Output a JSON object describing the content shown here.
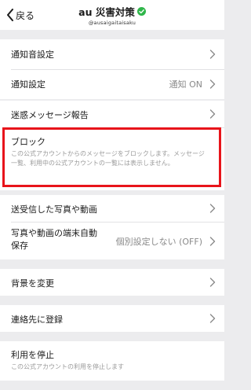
{
  "header": {
    "back_label": "戻る",
    "title": "au 災害対策",
    "handle": "@ausaigaitaisaku"
  },
  "settings": {
    "notification_sound": {
      "label": "通知音設定"
    },
    "notification": {
      "label": "通知設定",
      "value": "通知 ON"
    },
    "spam_report": {
      "label": "迷惑メッセージ報告"
    },
    "block": {
      "label": "ブロック",
      "description": "この公式アカウントからのメッセージをブロックします。メッセージ一覧、利用中の公式アカウントの一覧には表示しません。"
    },
    "sent_media": {
      "label": "送受信した写真や動画"
    },
    "auto_save": {
      "label_line1": "写真や動画の端末自動",
      "label_line2": "保存",
      "value": "個別設定しない (OFF)"
    },
    "background": {
      "label": "背景を変更"
    },
    "register_contact": {
      "label": "連絡先に登録"
    },
    "stop_using": {
      "label": "利用を停止",
      "description": "この公式アカウントの利用を停止します"
    }
  },
  "colors": {
    "background": "#ececee",
    "surface": "#ffffff",
    "highlight": "#e8141b",
    "verified": "#2fb64a"
  }
}
